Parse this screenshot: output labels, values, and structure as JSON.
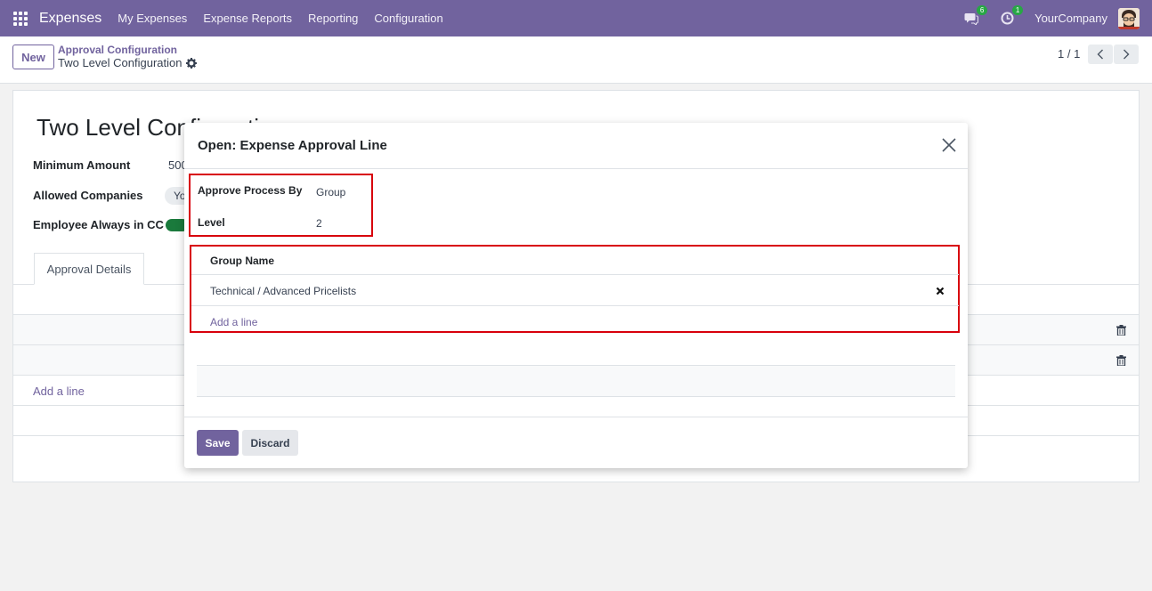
{
  "navbar": {
    "app_name": "Expenses",
    "menus": [
      "My Expenses",
      "Expense Reports",
      "Reporting",
      "Configuration"
    ],
    "messages_badge": "6",
    "activities_badge": "1",
    "company": "YourCompany"
  },
  "control_panel": {
    "new_label": "New",
    "breadcrumb_parent": "Approval Configuration",
    "breadcrumb_current": "Two Level Configuration",
    "pager": "1 / 1"
  },
  "form": {
    "title": "Two Level Configuration",
    "minimum_amount_label": "Minimum Amount",
    "minimum_amount_value": "500",
    "allowed_companies_label": "Allowed Companies",
    "allowed_companies_chip": "Yo",
    "employee_cc_label": "Employee Always in CC",
    "tab_label": "Approval Details",
    "add_line": "Add a line"
  },
  "modal": {
    "title": "Open: Expense Approval Line",
    "approve_process_label": "Approve Process By",
    "approve_process_value": "Group",
    "level_label": "Level",
    "level_value": "2",
    "column_group_name": "Group Name",
    "rows": [
      "Technical / Advanced Pricelists"
    ],
    "add_line": "Add a line",
    "save_label": "Save",
    "discard_label": "Discard"
  },
  "colors": {
    "brand": "#71639e",
    "highlight": "#d8000c",
    "toggle_on": "#1a7a3c",
    "badge": "#28a745"
  }
}
